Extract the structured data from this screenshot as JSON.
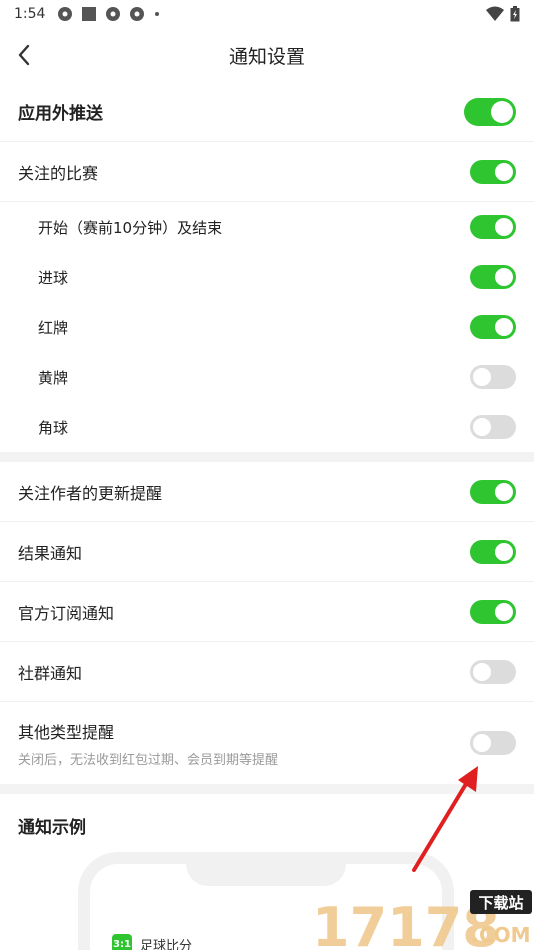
{
  "status_bar": {
    "time": "1:54"
  },
  "header": {
    "title": "通知设置"
  },
  "settings": {
    "push": {
      "label": "应用外推送",
      "on": true
    },
    "followed": {
      "label": "关注的比赛",
      "on": true
    },
    "sub_items": [
      {
        "label": "开始（赛前10分钟）及结束",
        "on": true
      },
      {
        "label": "进球",
        "on": true
      },
      {
        "label": "红牌",
        "on": true
      },
      {
        "label": "黄牌",
        "on": false
      },
      {
        "label": "角球",
        "on": false
      }
    ],
    "group2": [
      {
        "label": "关注作者的更新提醒",
        "on": true
      },
      {
        "label": "结果通知",
        "on": true
      },
      {
        "label": "官方订阅通知",
        "on": true
      },
      {
        "label": "社群通知",
        "on": false
      }
    ],
    "other": {
      "label": "其他类型提醒",
      "desc": "关闭后，无法收到红包过期、会员到期等提醒",
      "on": false
    }
  },
  "example": {
    "title": "通知示例",
    "app_icon_text": "3:1",
    "app_name": "足球比分"
  },
  "watermark": {
    "text": "17178",
    "tag": "下载站",
    "domain": ".COM"
  },
  "colors": {
    "toggle_on": "#2ec531",
    "toggle_off": "#dcdcdc",
    "arrow": "#e02020"
  }
}
